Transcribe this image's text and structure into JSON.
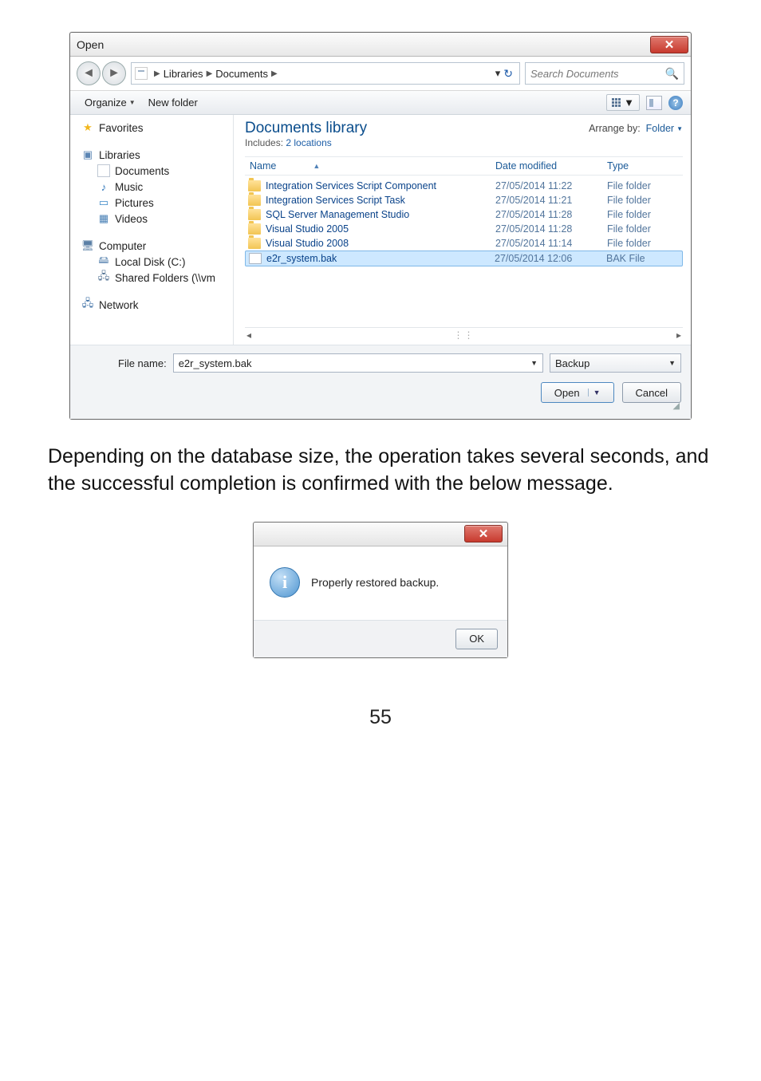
{
  "open_dialog": {
    "title": "Open",
    "breadcrumb": [
      "Libraries",
      "Documents"
    ],
    "search_placeholder": "Search Documents",
    "toolbar": {
      "organize": "Organize",
      "new_folder": "New folder"
    },
    "nav": {
      "favorites": "Favorites",
      "libraries": "Libraries",
      "lib_items": {
        "documents": "Documents",
        "music": "Music",
        "pictures": "Pictures",
        "videos": "Videos"
      },
      "computer": "Computer",
      "comp_items": {
        "local_disk": "Local Disk (C:)",
        "shared": "Shared Folders (\\\\vm"
      },
      "network": "Network"
    },
    "library_header": {
      "title": "Documents library",
      "includes_label": "Includes:",
      "includes_link": "2 locations",
      "arrange_label": "Arrange by:",
      "arrange_value": "Folder"
    },
    "columns": {
      "name": "Name",
      "date": "Date modified",
      "type": "Type"
    },
    "files": [
      {
        "name": "Integration Services Script Component",
        "date": "27/05/2014 11:22",
        "type": "File folder",
        "kind": "folder"
      },
      {
        "name": "Integration Services Script Task",
        "date": "27/05/2014 11:21",
        "type": "File folder",
        "kind": "folder"
      },
      {
        "name": "SQL Server Management Studio",
        "date": "27/05/2014 11:28",
        "type": "File folder",
        "kind": "folder"
      },
      {
        "name": "Visual Studio 2005",
        "date": "27/05/2014 11:28",
        "type": "File folder",
        "kind": "folder"
      },
      {
        "name": "Visual Studio 2008",
        "date": "27/05/2014 11:14",
        "type": "File folder",
        "kind": "folder"
      },
      {
        "name": "e2r_system.bak",
        "date": "27/05/2014 12:06",
        "type": "BAK File",
        "kind": "bak",
        "selected": true
      }
    ],
    "file_name_label": "File name:",
    "file_name_value": "e2r_system.bak",
    "filter_value": "Backup",
    "open_btn": "Open",
    "cancel_btn": "Cancel"
  },
  "body_text": "Depending on the database size, the operation takes several seconds, and the successful completion is confirmed with the below message.",
  "msg_dialog": {
    "text": "Properly restored backup.",
    "ok": "OK"
  },
  "page_number": "55"
}
